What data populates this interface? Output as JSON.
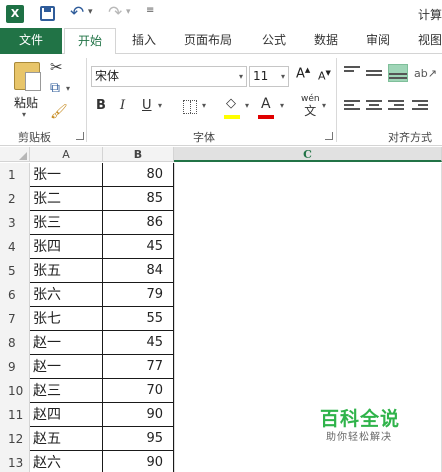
{
  "window": {
    "title": "计算"
  },
  "qat": {
    "excel_logo": "X",
    "icons": [
      "excel-logo-icon",
      "save-icon",
      "undo-icon",
      "redo-icon",
      "customize-qat-icon"
    ]
  },
  "tabs": [
    {
      "label": "文件"
    },
    {
      "label": "开始"
    },
    {
      "label": "插入"
    },
    {
      "label": "页面布局"
    },
    {
      "label": "公式"
    },
    {
      "label": "数据"
    },
    {
      "label": "审阅"
    },
    {
      "label": "视图"
    }
  ],
  "active_tab": "开始",
  "ribbon": {
    "clipboard": {
      "paste_label": "粘贴",
      "group_label": "剪贴板"
    },
    "font": {
      "group_label": "字体",
      "font_name": "宋体",
      "font_size": "11",
      "bold": "B",
      "italic": "I",
      "underline": "U",
      "grow": "A",
      "shrink": "A",
      "font_color_glyph": "A",
      "phonetic_top": "wén",
      "phonetic_bottom": "文",
      "fill_color": "#ffff00",
      "font_color": "#e00000"
    },
    "alignment": {
      "group_label": "对齐方式"
    }
  },
  "sheet": {
    "columns": [
      "A",
      "B",
      "C"
    ],
    "selected_column": "C",
    "rows": [
      {
        "num": "1",
        "name": "张一",
        "score": "80"
      },
      {
        "num": "2",
        "name": "张二",
        "score": "85"
      },
      {
        "num": "3",
        "name": "张三",
        "score": "86"
      },
      {
        "num": "4",
        "name": "张四",
        "score": "45"
      },
      {
        "num": "5",
        "name": "张五",
        "score": "84"
      },
      {
        "num": "6",
        "name": "张六",
        "score": "79"
      },
      {
        "num": "7",
        "name": "张七",
        "score": "55"
      },
      {
        "num": "8",
        "name": "赵一",
        "score": "45"
      },
      {
        "num": "9",
        "name": "赵一",
        "score": "77"
      },
      {
        "num": "10",
        "name": "赵三",
        "score": "70"
      },
      {
        "num": "11",
        "name": "赵四",
        "score": "90"
      },
      {
        "num": "12",
        "name": "赵五",
        "score": "95"
      },
      {
        "num": "13",
        "name": "赵六",
        "score": "90"
      }
    ]
  },
  "watermark": {
    "main": "百科全说",
    "sub": "助你轻松解决"
  },
  "colors": {
    "accent": "#217346",
    "selected_header_bg": "#e1e1e1",
    "watermark_green": "#2fb34a"
  }
}
